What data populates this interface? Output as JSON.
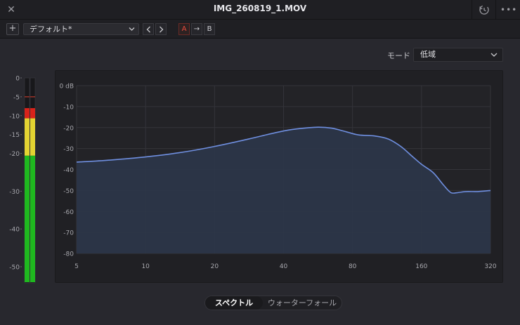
{
  "window": {
    "title": "IMG_260819_1.MOV",
    "close_glyph": "✕",
    "more_glyph": "•••"
  },
  "toolbar": {
    "add_glyph": "+",
    "preset_label": "デフォルト*",
    "a_label": "A",
    "copy_glyph": "→",
    "b_label": "B"
  },
  "mode": {
    "label": "モード",
    "value": "低域"
  },
  "meter": {
    "scale_labels": [
      "0",
      "-5",
      "-10",
      "-15",
      "-20",
      "-30",
      "-40",
      "-50"
    ],
    "scale_values": [
      0,
      -5,
      -10,
      -15,
      -20,
      -30,
      -40,
      -50
    ],
    "min_db": -50,
    "max_db": 0,
    "peak_hold_db": -5,
    "level_db": -8,
    "colors": {
      "green": "#1fb81f",
      "yellow": "#e3d332",
      "red": "#d8231b",
      "peak": "#c0392b"
    }
  },
  "chart_data": {
    "type": "area",
    "title": "",
    "xlabel": "",
    "ylabel": "",
    "x_scale": "log",
    "xlim": [
      5,
      320
    ],
    "ylim": [
      -80,
      0
    ],
    "x_ticks": [
      5,
      10,
      20,
      40,
      80,
      160,
      320
    ],
    "x_tick_labels": [
      "5",
      "10",
      "20",
      "40",
      "80",
      "160",
      "320"
    ],
    "y_ticks": [
      0,
      -10,
      -20,
      -30,
      -40,
      -50,
      -60,
      -70,
      -80
    ],
    "y_tick_labels": [
      "0 dB",
      "-10",
      "-20",
      "-30",
      "-40",
      "-50",
      "-60",
      "-70",
      "-80"
    ],
    "grid": true,
    "series": [
      {
        "line_color": "#6f8fe0",
        "fill_color": "#2c3649",
        "x": [
          5,
          7,
          10,
          14,
          20,
          28,
          35,
          42,
          50,
          57,
          65,
          75,
          85,
          100,
          115,
          130,
          145,
          160,
          180,
          200,
          215,
          230,
          250,
          280,
          320
        ],
        "y": [
          -36.5,
          -35.5,
          -34,
          -32,
          -29,
          -25.5,
          -23,
          -21.2,
          -20.2,
          -19.8,
          -20.3,
          -22,
          -23.5,
          -24,
          -25.5,
          -29,
          -33.5,
          -37.5,
          -41.5,
          -47.5,
          -51,
          -51,
          -50.5,
          -50.5,
          -50
        ]
      }
    ]
  }
}
